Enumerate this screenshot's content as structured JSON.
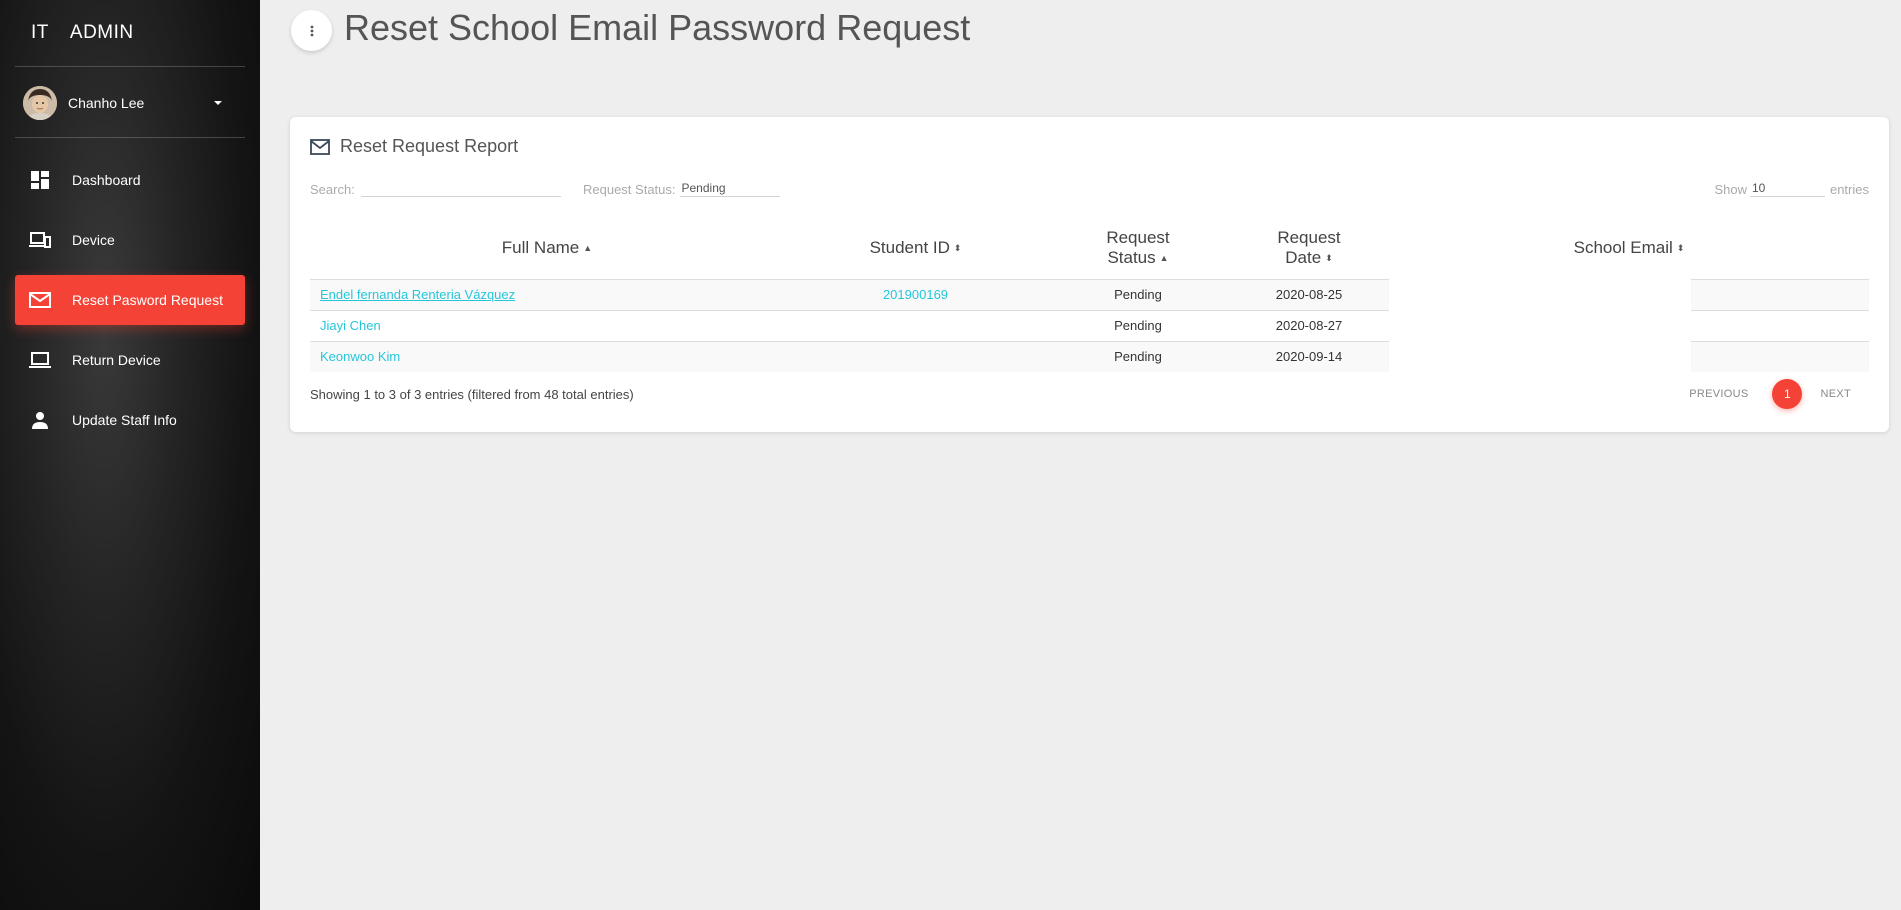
{
  "app": {
    "brand_left": "IT",
    "brand_right": "ADMIN"
  },
  "user": {
    "name": "Chanho Lee"
  },
  "sidebar": {
    "items": [
      {
        "label": "Dashboard",
        "icon": "dashboard-icon"
      },
      {
        "label": "Device",
        "icon": "devices-icon"
      },
      {
        "label": "Reset Pasword Request",
        "icon": "mail-icon",
        "active": true
      },
      {
        "label": "Return Device",
        "icon": "laptop-icon"
      },
      {
        "label": "Update Staff Info",
        "icon": "person-icon"
      }
    ]
  },
  "header": {
    "title": "Reset School Email Password Request"
  },
  "card": {
    "title": "Reset Request Report",
    "search_label": "Search:",
    "search_value": "",
    "status_label": "Request Status:",
    "status_value": "Pending",
    "show_label": "Show",
    "show_value": "10",
    "entries_label": "entries",
    "columns": {
      "full_name": "Full Name",
      "student_id": "Student ID",
      "request_status_1": "Request",
      "request_status_2": "Status",
      "request_date_1": "Request",
      "request_date_2": "Date",
      "school_email": "School Email"
    },
    "rows": [
      {
        "name": "Endel fernanda Renteria Vázquez",
        "student_id": "201900169",
        "status": "Pending",
        "date": "2020-08-25",
        "email": ""
      },
      {
        "name": "Jiayi Chen",
        "student_id": "",
        "status": "Pending",
        "date": "2020-08-27",
        "email": ""
      },
      {
        "name": "Keonwoo Kim",
        "student_id": "",
        "status": "Pending",
        "date": "2020-09-14",
        "email": ""
      }
    ],
    "info": "Showing 1 to 3 of 3 entries (filtered from 48 total entries)",
    "pager": {
      "previous": "PREVIOUS",
      "current": "1",
      "next": "NEXT"
    }
  },
  "colors": {
    "accent": "#f44336",
    "link": "#26c6da",
    "background": "#eeeeee"
  }
}
